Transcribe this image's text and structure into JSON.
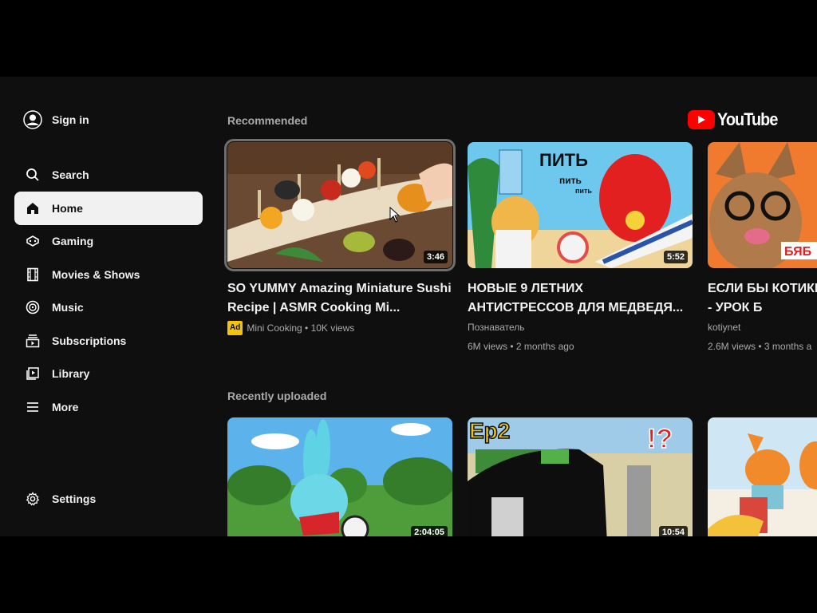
{
  "sidebar": {
    "sign_in": "Sign in",
    "items": [
      {
        "label": "Search",
        "icon": "search-icon"
      },
      {
        "label": "Home",
        "icon": "home-icon",
        "active": true
      },
      {
        "label": "Gaming",
        "icon": "gaming-icon"
      },
      {
        "label": "Movies & Shows",
        "icon": "movies-icon"
      },
      {
        "label": "Music",
        "icon": "music-icon"
      },
      {
        "label": "Subscriptions",
        "icon": "subscriptions-icon"
      },
      {
        "label": "Library",
        "icon": "library-icon"
      },
      {
        "label": "More",
        "icon": "menu-icon"
      }
    ],
    "settings": "Settings"
  },
  "brand": {
    "logo_text": "YouTube",
    "color": "#ff0000"
  },
  "sections": {
    "recommended": {
      "title": "Recommended",
      "videos": [
        {
          "title": "SO YUMMY Amazing Miniature Sushi Recipe | ASMR Cooking Mi...",
          "ad": "Ad",
          "meta": "Mini Cooking • 10K views",
          "duration": "3:46"
        },
        {
          "title": "НОВЫЕ 9 ЛЕТНИХ АНТИСТРЕССОВ ДЛЯ МЕДВЕДЯ...",
          "channel": "Познаватель",
          "meta": "6M views • 2 months ago",
          "duration": "5:52"
        },
        {
          "title": "ЕСЛИ БЫ КОТИКИ ПОШЛИ В ШКОЛУ - УРОК Б",
          "channel": "kotiynet",
          "meta": "2.6M views • 3 months a"
        }
      ]
    },
    "recent": {
      "title": "Recently uploaded",
      "videos": [
        {
          "duration": "2:04:05"
        },
        {
          "duration": "10:54"
        },
        {}
      ]
    }
  },
  "colors": {
    "background": "#0f0f0f",
    "active_item": "#f1f1f1",
    "ad_badge": "#f4c20d",
    "secondary_text": "#aaaaaa"
  }
}
